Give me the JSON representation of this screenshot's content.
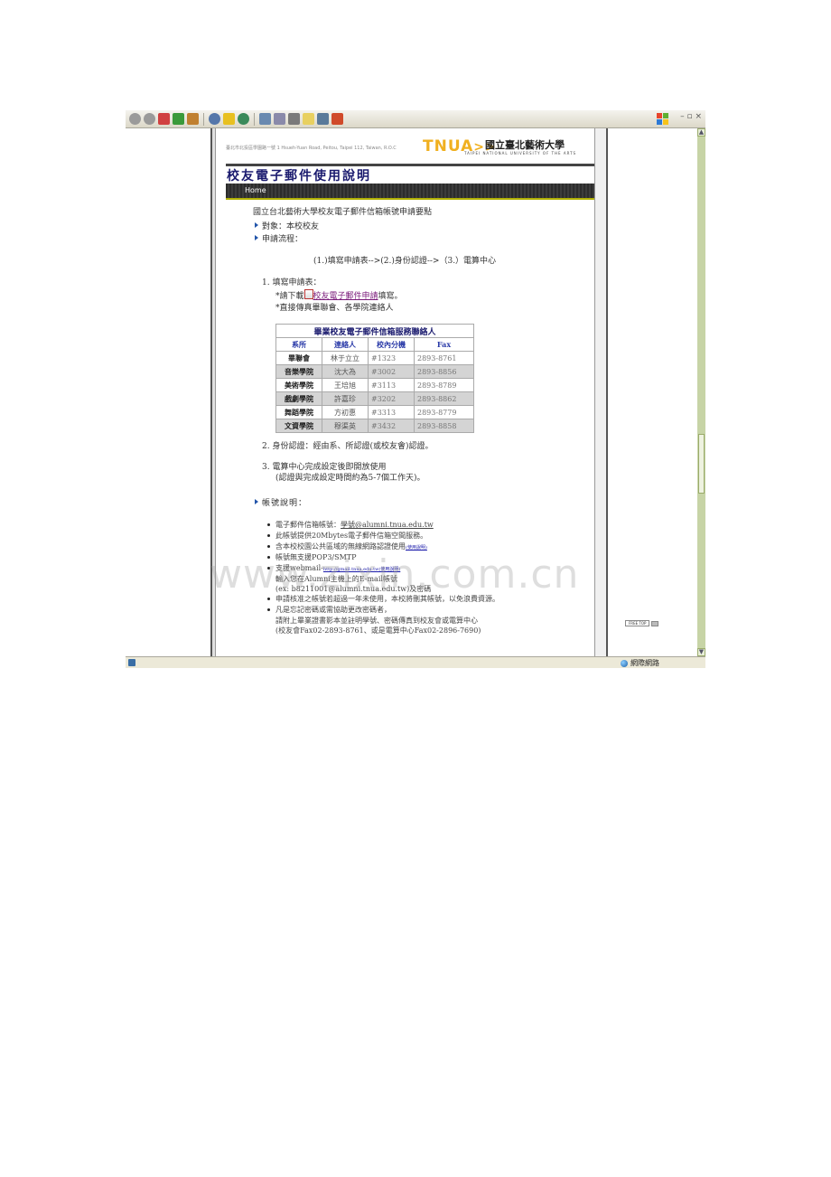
{
  "browser": {
    "status_zone": "網際網路"
  },
  "header": {
    "address": "臺北市北投區學園路一號 1 Hsueh-Yuan Road, Peitou, Taipei 112, Taiwan, R.O.C",
    "logo_text": "TNUA",
    "logo_chevrons": ">>",
    "university_name": "國立臺北藝術大學",
    "university_name_en": "TAIPEI NATIONAL UNIVERSITY OF THE ARTS"
  },
  "page": {
    "title": "校友電子郵件使用說明",
    "nav_home": "Home",
    "heading": "國立台北藝術大學校友電子郵件信箱帳號申請要點",
    "target": "對象：本校校友",
    "process_label": "申請流程：",
    "process_steps": "(1.)填寫申請表-->(2.)身份認證-->（3.）電算中心",
    "step1_label": "1.  填寫申請表：",
    "step1_line1_pre": "*請下載",
    "step1_link": "校友電子郵件申請",
    "step1_line1_post": "填寫。",
    "step1_line2": "*直接傳真畢聯會、各學院連絡人",
    "step2": "2.  身份認證：經由系、所認證(或校友會)認證。",
    "step3_line1": "3.  電算中心完成設定後即開放使用",
    "step3_line2": "(認證與完成設定時間約為5-7個工作天)。",
    "account_label": "帳號說明：",
    "free_top": "FREE TOP"
  },
  "contact_table": {
    "caption": "畢業校友電子郵件信箱服務聯絡人",
    "headers": [
      "系所",
      "連絡人",
      "校內分機",
      "Fax"
    ],
    "rows": [
      [
        "畢聯會",
        "林于立立",
        "#1323",
        "2893-8761"
      ],
      [
        "音樂學院",
        "沈大為",
        "#3002",
        "2893-8856"
      ],
      [
        "美術學院",
        "王培旭",
        "#3113",
        "2893-8789"
      ],
      [
        "戲劇學院",
        "許嘉珍",
        "#3202",
        "2893-8862"
      ],
      [
        "舞蹈學院",
        "方初惠",
        "#3313",
        "2893-8779"
      ],
      [
        "文資學院",
        "穆渠英",
        "#3432",
        "2893-8858"
      ]
    ]
  },
  "account_notes": {
    "item1_pre": "電子郵件信箱帳號：",
    "item1_value": "學號@alumni.tnua.edu.tw",
    "item2": "此帳號提供20Mbytes電子郵件信箱空間服務。",
    "item3_pre": "含本校校園公共區域的無線網路認證使用",
    "item3_link": "(使用說明)",
    "item4": "帳號無支援POP3/SMTP",
    "item5_pre": "支援webmail-",
    "item5_link": "http://gmail.tnua.edu.tw(使用說明)",
    "item5_line2": "輸入您在Alumni主機上的E-mail帳號",
    "item5_line3": "(ex: b8211001@alumni.tnua.edu.tw)及密碼",
    "item6": "申請核准之帳號若超過一年未使用，本校將刪其帳號，以免浪費資源。",
    "item7_line1": "凡是忘記密碼或需協助更改密碼者，",
    "item7_line2": "請附上畢業證書影本並註明學號、密碼傳真到校友會或電算中心",
    "item7_line3": "(校友會Fax02-2893-8761、或是電算中心Fax02-2896-7690)"
  },
  "watermark": "www.zixin.com.cn",
  "colors": {
    "title": "#1a1a6e",
    "logo": "#f0b020",
    "link": "#7a1a7a",
    "scrollbar": "#c7d4a6"
  }
}
